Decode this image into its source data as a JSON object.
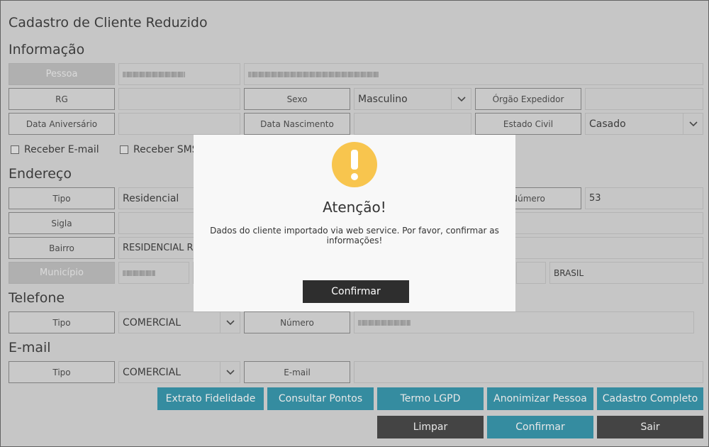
{
  "page": {
    "title": "Cadastro de Cliente Reduzido"
  },
  "sections": {
    "informacao": "Informação",
    "endereco": "Endereço",
    "telefone": "Telefone",
    "email": "E-mail"
  },
  "info": {
    "pessoa_label": "Pessoa",
    "rg_label": "RG",
    "sexo_label": "Sexo",
    "sexo_value": "Masculino",
    "orgao_label": "Órgão Expedidor",
    "data_aniversario_label": "Data Aniversário",
    "data_nascimento_label": "Data Nascimento",
    "estado_civil_label": "Estado Civil",
    "estado_civil_value": "Casado",
    "receber_email": "Receber E-mail",
    "receber_sms": "Receber SMS"
  },
  "endereco": {
    "tipo_label": "Tipo",
    "tipo_value": "Residencial",
    "numero_label": "Número",
    "numero_value": "53",
    "sigla_label": "Sigla",
    "bairro_label": "Bairro",
    "bairro_value": "RESIDENCIAL REGE",
    "municipio_label": "Município",
    "pais_value": "BRASIL"
  },
  "telefone": {
    "tipo_label": "Tipo",
    "tipo_value": "COMERCIAL",
    "numero_label": "Número"
  },
  "email": {
    "tipo_label": "Tipo",
    "tipo_value": "COMERCIAL",
    "email_label": "E-mail"
  },
  "actions": {
    "extrato": "Extrato Fidelidade",
    "consultar": "Consultar Pontos",
    "termo": "Termo LGPD",
    "anonimizar": "Anonimizar Pessoa",
    "cadastro": "Cadastro Completo",
    "limpar": "Limpar",
    "confirmar": "Confirmar",
    "sair": "Sair"
  },
  "modal": {
    "title": "Atenção!",
    "message": "Dados do cliente importado via web service. Por favor, confirmar as informações!",
    "button": "Confirmar"
  },
  "colors": {
    "teal": "#1a8aa3",
    "dark": "#2e2e2e",
    "warning": "#f8c54e"
  }
}
